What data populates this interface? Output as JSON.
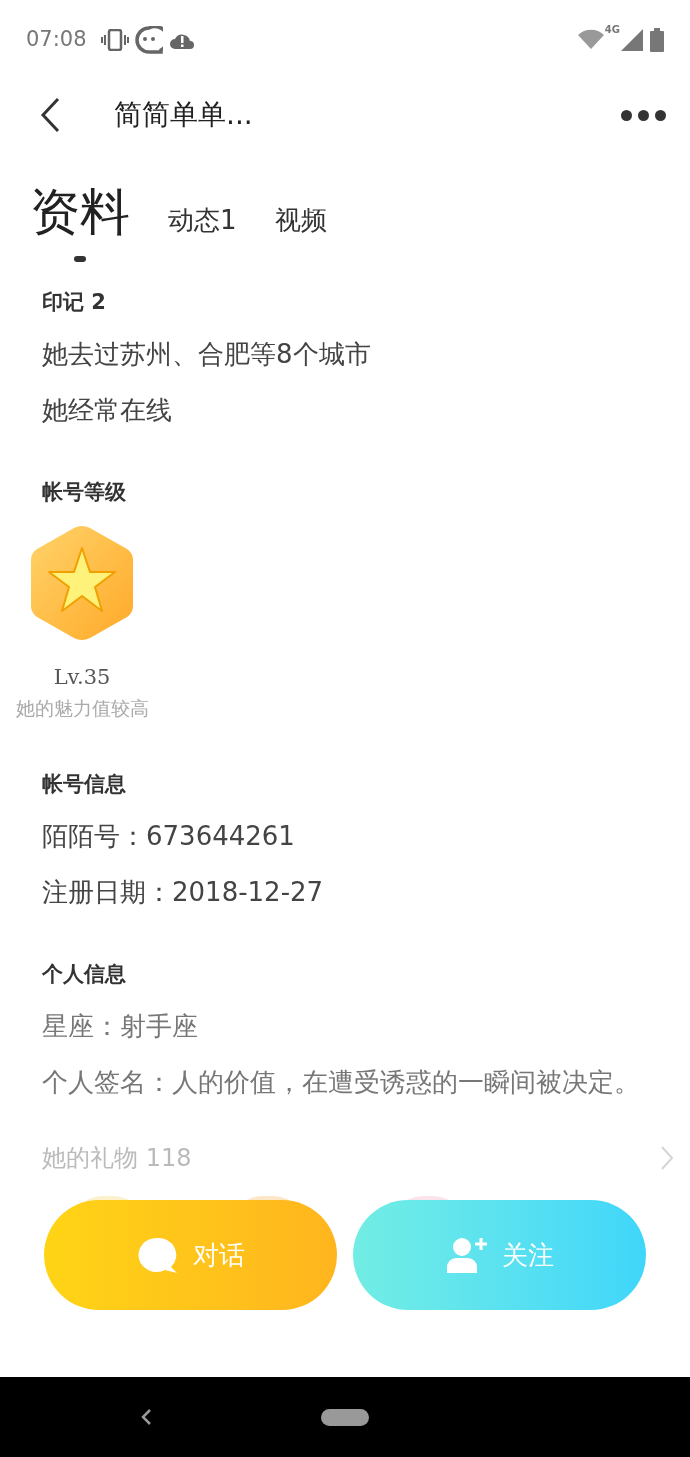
{
  "status_bar": {
    "time": "07:08",
    "network": "4G"
  },
  "header": {
    "title": "简简单单..."
  },
  "tabs": [
    {
      "label": "资料",
      "selected": true
    },
    {
      "label": "动态1",
      "selected": false
    },
    {
      "label": "视频",
      "selected": false
    }
  ],
  "sections": [
    {
      "title": "印记 2",
      "kind": "lines",
      "lines": [
        "她去过苏州、合肥等8个城市",
        "她经常在线"
      ]
    },
    {
      "title": "帐号等级",
      "kind": "level",
      "level_label": "Lv.35",
      "caption": "她的魅力值较高"
    },
    {
      "title": "帐号信息",
      "kind": "lines",
      "lines": [
        "陌陌号：673644261",
        "注册日期：2018-12-27"
      ]
    },
    {
      "title": "个人信息",
      "kind": "lines",
      "lines": [
        "星座：射手座",
        "个人签名：人的价值，在遭受诱惑的一瞬间被决定。"
      ]
    }
  ],
  "gifts": {
    "title": "她的礼物 118"
  },
  "actions": [
    {
      "label": "对话",
      "kind": "chat"
    },
    {
      "label": "关注",
      "kind": "follow"
    }
  ]
}
